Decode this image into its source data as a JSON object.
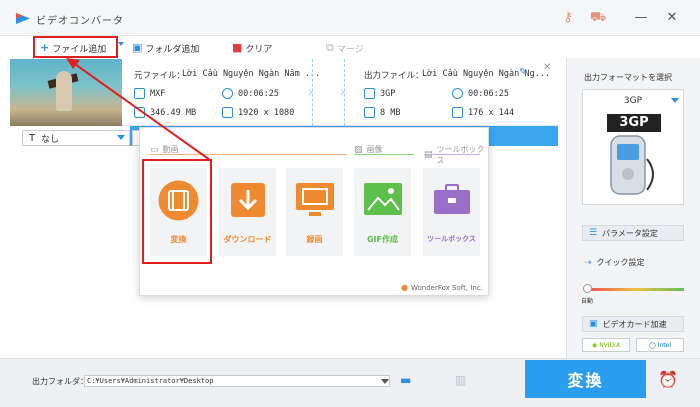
{
  "app": {
    "title": "ビデオコンバータ"
  },
  "toolbar": {
    "add_file": "ファイル追加",
    "add_folder": "フォルダ追加",
    "clear": "クリア",
    "merge": "マージ"
  },
  "file": {
    "source_label": "元ファイル：",
    "source_name": "Lời Cầu Nguyện Ngàn Năm ...",
    "source_format": "MXF",
    "source_duration": "00:06:25",
    "source_size": "346.49 MB",
    "source_resolution": "1920 x 1080",
    "output_label": "出力ファイル：",
    "output_name": "Lời Cầu Nguyện Ngàn Ng...",
    "output_format": "3GP",
    "output_duration": "00:06:25",
    "output_size": "8 MB",
    "output_resolution": "176 x 144"
  },
  "options": {
    "subtitle_value": "なし"
  },
  "popup": {
    "categories": {
      "video": "動画",
      "image": "画像",
      "toolbox": "ツールボックス"
    },
    "tiles": {
      "convert": "変換",
      "download": "ダウンロード",
      "record": "録画",
      "gif": "GIF作成",
      "toolbox": "ツールボックス"
    },
    "brand": "WonderFox Soft, Inc."
  },
  "right_panel": {
    "select_format_label": "出力フォーマットを選択",
    "format_name": "3GP",
    "format_badge": "3GP",
    "param_button": "パラメータ設定",
    "quick_setting": "クイック設定",
    "slider_label": "自動",
    "gpu_button": "ビデオカード加速",
    "nvidia": "NVIDIA",
    "intel": "Intel"
  },
  "bottom": {
    "output_folder_label": "出力フォルダ：",
    "output_folder_path": "C:¥Users¥Administrator¥Desktop",
    "convert_button": "変換"
  },
  "colors": {
    "accent": "#2b9df0",
    "highlight": "#e02020",
    "orange": "#f08a30",
    "green": "#5cc04a",
    "purple": "#9a6fc8"
  }
}
